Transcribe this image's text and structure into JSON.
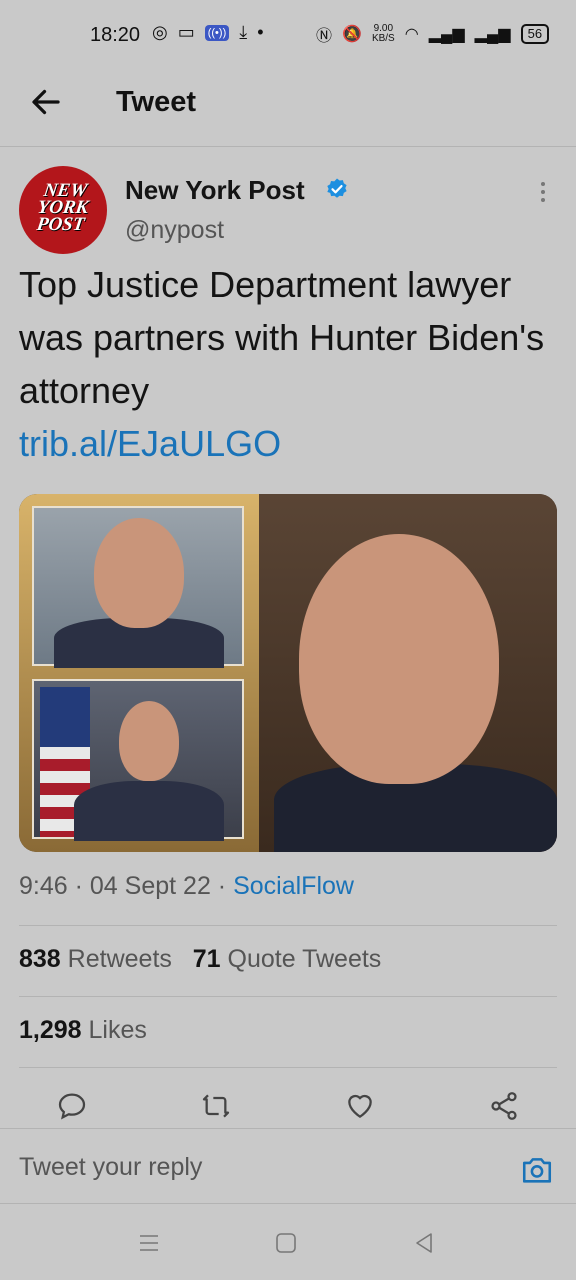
{
  "status_bar": {
    "time": "18:20",
    "net_speed_value": "9.00",
    "net_speed_unit": "KB/S",
    "battery": "56"
  },
  "header": {
    "title": "Tweet"
  },
  "tweet": {
    "author_name": "New York Post",
    "author_handle": "@nypost",
    "avatar_logo": "NEW YORK POST",
    "text": "Top Justice Department lawyer was partners with Hunter Biden's attorney",
    "link": "trib.al/EJaULGO",
    "time": "9:46",
    "date": "04 Sept 22",
    "source": "SocialFlow",
    "separator": "·"
  },
  "stats": {
    "retweets_count": "838",
    "retweets_label": "Retweets",
    "quotes_count": "71",
    "quotes_label": "Quote Tweets",
    "likes_count": "1,298",
    "likes_label": "Likes"
  },
  "reply": {
    "placeholder": "Tweet your reply"
  },
  "colors": {
    "accent": "#1a73b8",
    "background": "#c9c9c9",
    "verified": "#1d8fe0"
  }
}
